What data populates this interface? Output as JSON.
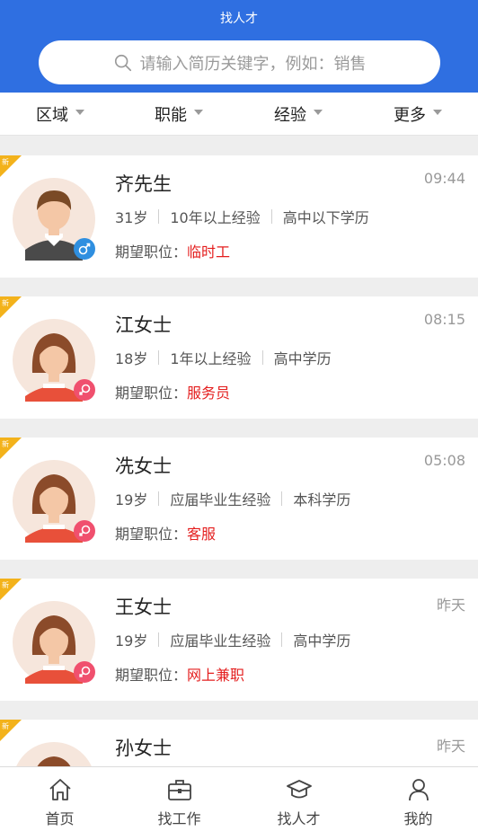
{
  "header": {
    "title": "找人才",
    "search_placeholder": "请输入简历关键字，例如：销售"
  },
  "filters": [
    "区域",
    "职能",
    "经验",
    "更多"
  ],
  "candidates": [
    {
      "name": "齐先生",
      "time": "09:44",
      "age": "31岁",
      "experience": "10年以上经验",
      "education": "高中以下学历",
      "want_label": "期望职位：",
      "position": "临时工",
      "gender": "male",
      "badge": "新"
    },
    {
      "name": "江女士",
      "time": "08:15",
      "age": "18岁",
      "experience": "1年以上经验",
      "education": "高中学历",
      "want_label": "期望职位：",
      "position": "服务员",
      "gender": "female",
      "badge": "新"
    },
    {
      "name": "冼女士",
      "time": "05:08",
      "age": "19岁",
      "experience": "应届毕业生经验",
      "education": "本科学历",
      "want_label": "期望职位：",
      "position": "客服",
      "gender": "female",
      "badge": "新"
    },
    {
      "name": "王女士",
      "time": "昨天",
      "age": "19岁",
      "experience": "应届毕业生经验",
      "education": "高中学历",
      "want_label": "期望职位：",
      "position": "网上兼职",
      "gender": "female",
      "badge": "新"
    },
    {
      "name": "孙女士",
      "time": "昨天",
      "badge": "新",
      "gender": "female"
    }
  ],
  "nav": [
    "首页",
    "找工作",
    "找人才",
    "我的"
  ],
  "colors": {
    "primary": "#2f6fe1",
    "accent_red": "#e41e1e",
    "badge": "#f3b21b",
    "male": "#2f8fe0",
    "female": "#f0506e"
  }
}
